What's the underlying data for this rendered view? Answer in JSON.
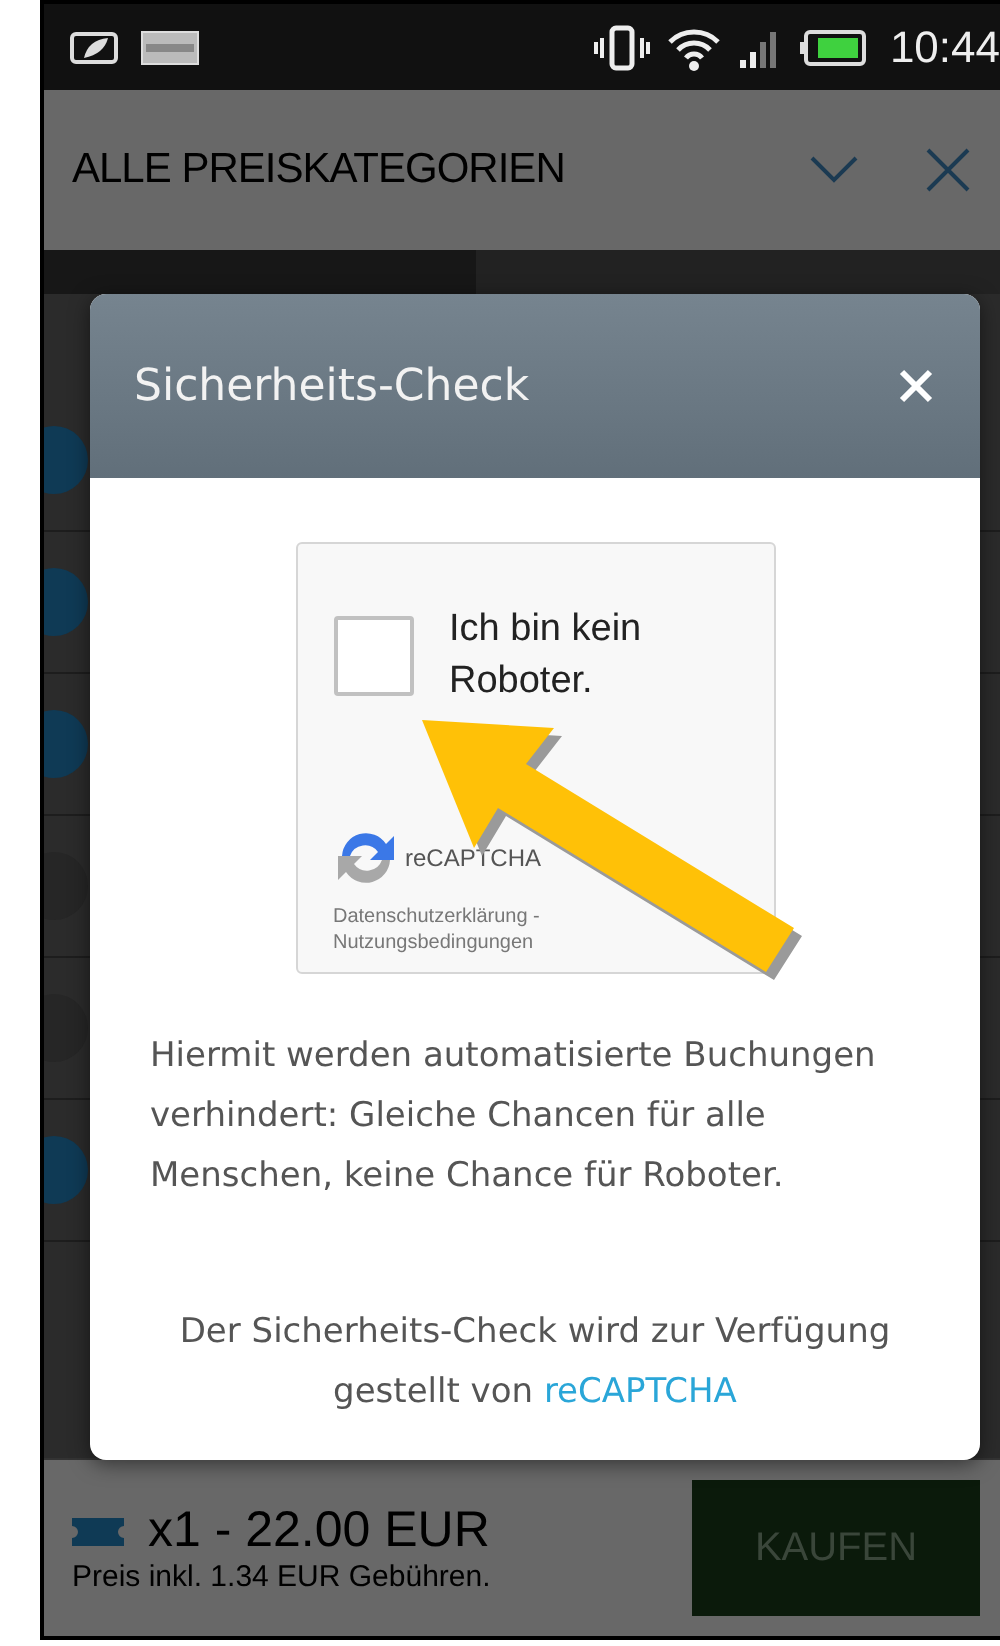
{
  "status_bar": {
    "time": "10:44"
  },
  "app_bar": {
    "title": "ALLE PREISKATEGORIEN"
  },
  "background_rows": [
    {
      "color": "#0f3a55"
    },
    {
      "color": "#0f3a55"
    },
    {
      "color": "#0f3a55"
    },
    {
      "color": "#262626"
    },
    {
      "color": "#262626"
    },
    {
      "color": "#0f3a55"
    }
  ],
  "dialog": {
    "title": "Sicherheits-Check",
    "captcha": {
      "label": "Ich bin kein Roboter.",
      "checked": false,
      "brand": "reCAPTCHA",
      "privacy": "Datenschutzerklärung -",
      "terms": "Nutzungsbedingungen"
    },
    "description": "Hiermit werden automatisierte Buchungen verhindert: Gleiche Chancen für alle Menschen, keine Chance für Roboter.",
    "provider_note": {
      "text": "Der Sicherheits-Check wird zur Verfügung gestellt von",
      "link": "reCAPTCHA"
    }
  },
  "cart": {
    "quantity": "x1 - 22.00 EUR",
    "fee_note": "Preis inkl. 1.34 EUR Gebühren.",
    "buy_button": "KAUFEN"
  }
}
